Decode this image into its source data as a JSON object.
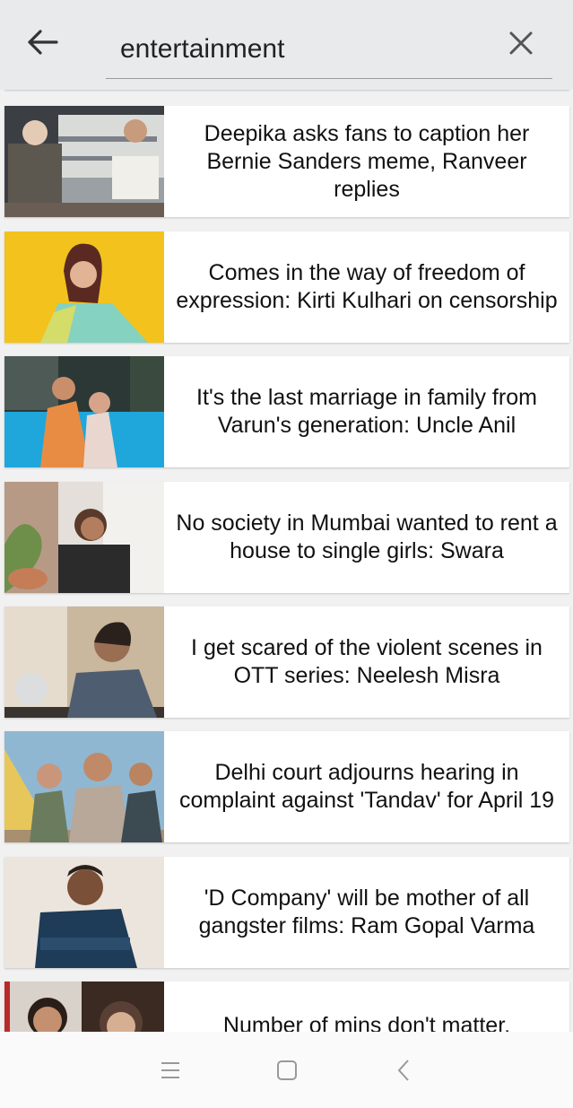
{
  "search": {
    "query": "entertainment",
    "back_icon": "arrow-left-icon",
    "clear_icon": "close-icon"
  },
  "articles": [
    {
      "headline": "Deepika asks fans to caption her Bernie Sanders meme, Ranveer replies",
      "thumb_colors": [
        "#4a4f54",
        "#cfd2cf"
      ]
    },
    {
      "headline": "Comes in the way of freedom of expression: Kirti Kulhari on censorship",
      "thumb_colors": [
        "#f2c11b",
        "#e9c93a"
      ]
    },
    {
      "headline": "It's the last marriage in family from Varun's generation: Uncle Anil",
      "thumb_colors": [
        "#2b3a38",
        "#1da5d8"
      ]
    },
    {
      "headline": "No society in Mumbai wanted to rent a house to single girls: Swara",
      "thumb_colors": [
        "#d8d3cf",
        "#8aa06a"
      ]
    },
    {
      "headline": "I get scared of the violent scenes in OTT series: Neelesh Misra",
      "thumb_colors": [
        "#c9b59a",
        "#4c5a6c"
      ]
    },
    {
      "headline": "Delhi court adjourns hearing in complaint against 'Tandav' for April 19",
      "thumb_colors": [
        "#8fb6d2",
        "#d9c270"
      ]
    },
    {
      "headline": "'D Company' will be mother of all gangster films: Ram Gopal Varma",
      "thumb_colors": [
        "#e9e1d9",
        "#1f3d5a"
      ]
    },
    {
      "headline": "Number of mins don't matter,",
      "thumb_colors": [
        "#b58a6a",
        "#3a2a22"
      ]
    }
  ],
  "navbar": {
    "menu_icon": "menu-icon",
    "home_icon": "home-square-icon",
    "back_icon": "chevron-left-icon"
  }
}
